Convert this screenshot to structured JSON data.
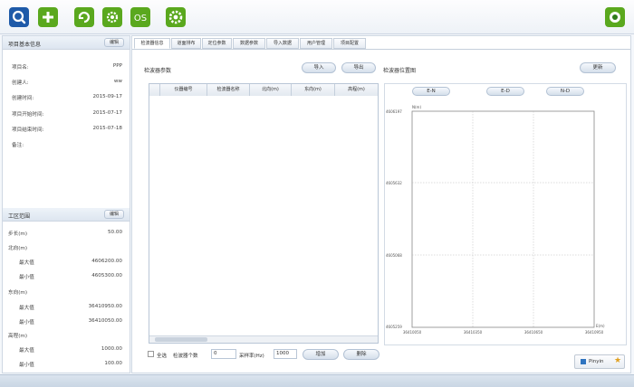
{
  "toolbar": {
    "buttons": [
      "search-icon",
      "add-icon",
      "refresh-icon",
      "settings-gear-icon",
      "os-icon",
      "gear-icon"
    ],
    "os_label": "OS"
  },
  "colors": {
    "blue": "#1e5aa8",
    "green": "#5aa81e",
    "accent": "#2f74c0"
  },
  "project_info": {
    "title": "项目基本信息",
    "edit_label": "编辑",
    "fields": [
      {
        "label": "项目名:",
        "value": "PPP"
      },
      {
        "label": "创建人:",
        "value": "ww"
      },
      {
        "label": "创建时间:",
        "value": "2015-09-17"
      },
      {
        "label": "项目开始时间:",
        "value": "2015-07-17"
      },
      {
        "label": "项目结束时间:",
        "value": "2015-07-18"
      },
      {
        "label": "备注:",
        "value": ""
      }
    ]
  },
  "work_range": {
    "title": "工区范围",
    "edit_label": "编辑",
    "step_label": "步长(m)",
    "step_value": "50.00",
    "north_label": "北向(m)",
    "north_max_label": "最大值",
    "north_max": "4606200.00",
    "north_min_label": "最小值",
    "north_min": "4605300.00",
    "east_label": "东向(m)",
    "east_max_label": "最大值",
    "east_max": "36410950.00",
    "east_min_label": "最小值",
    "east_min": "36410050.00",
    "elev_label": "高程(m)",
    "elev_max_label": "最大值",
    "elev_max": "1000.00",
    "elev_min_label": "最小值",
    "elev_min": "100.00"
  },
  "tabs": [
    "检波器信息",
    "道面排布",
    "定位参数",
    "数据参数",
    "导入数据",
    "用户管理",
    "项目配置"
  ],
  "detector": {
    "title": "检波器参数",
    "import_label": "导入",
    "export_label": "导出",
    "columns": [
      "仪器编号",
      "检波器名称",
      "北向(m)",
      "东向(m)",
      "高程(m)"
    ],
    "select_all_label": "全选",
    "count_label": "检波器个数",
    "count_value": "0",
    "rate_label": "采样率(Hz)",
    "rate_value": "1000",
    "add_label": "增加",
    "delete_label": "删除"
  },
  "position_plot": {
    "title": "检波器位置图",
    "update_label": "更新",
    "view_buttons": [
      "E-N",
      "E-D",
      "N-D"
    ],
    "y_axis_label": "N(m)",
    "x_axis_label": "E(m)",
    "y_ticks": [
      "4606197",
      "4605632",
      "4605068",
      "4605259"
    ],
    "x_ticks": [
      "36410050",
      "36410350",
      "36410650",
      "36410950"
    ]
  },
  "ime": {
    "label": "Pinyin"
  }
}
